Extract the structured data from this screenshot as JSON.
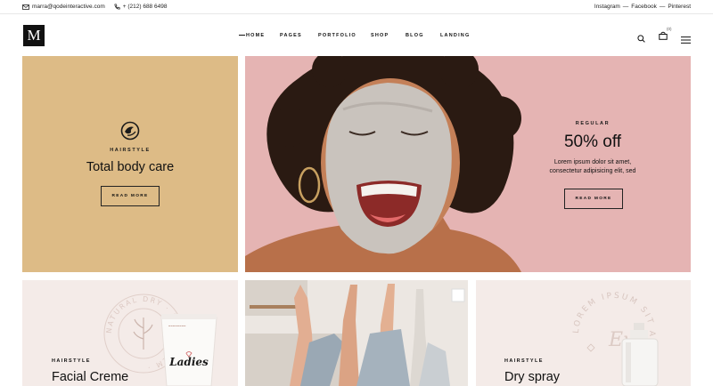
{
  "topbar": {
    "email": "marra@qodeinteractive.com",
    "phone": "+ (212) 688 6498",
    "social": [
      "Instagram",
      "—",
      "Facebook",
      "—",
      "Pinterest"
    ]
  },
  "header": {
    "logo_letter": "M",
    "nav": [
      "HOME",
      "PAGES",
      "PORTFOLIO",
      "SHOP",
      "BLOG",
      "LANDING"
    ],
    "cart_count": "0"
  },
  "hero_left": {
    "kicker": "HAIRSTYLE",
    "title": "Total body care",
    "button": "READ MORE"
  },
  "hero_right": {
    "kicker": "REGULAR",
    "title": "50% off",
    "text_line1": "Lorem ipsum dolor sit amet,",
    "text_line2": "consectetur adipisicing elit, sed",
    "button": "READ MORE"
  },
  "bottom": [
    {
      "kicker": "HAIRSTYLE",
      "title": "Facial Creme",
      "stamp_text": "NATURAL DRY · MADE BALM ·",
      "product_label": "Ladies"
    },
    {
      "kicker": "",
      "title": ""
    },
    {
      "kicker": "HAIRSTYLE",
      "title": "Dry spray",
      "stamp_text": "LOREM IPSUM SIT AMET ·",
      "script_text": "Eye"
    }
  ],
  "colors": {
    "tan": "#ddbb86",
    "pink": "#e5b4b3",
    "blush": "#f4ebe8"
  }
}
